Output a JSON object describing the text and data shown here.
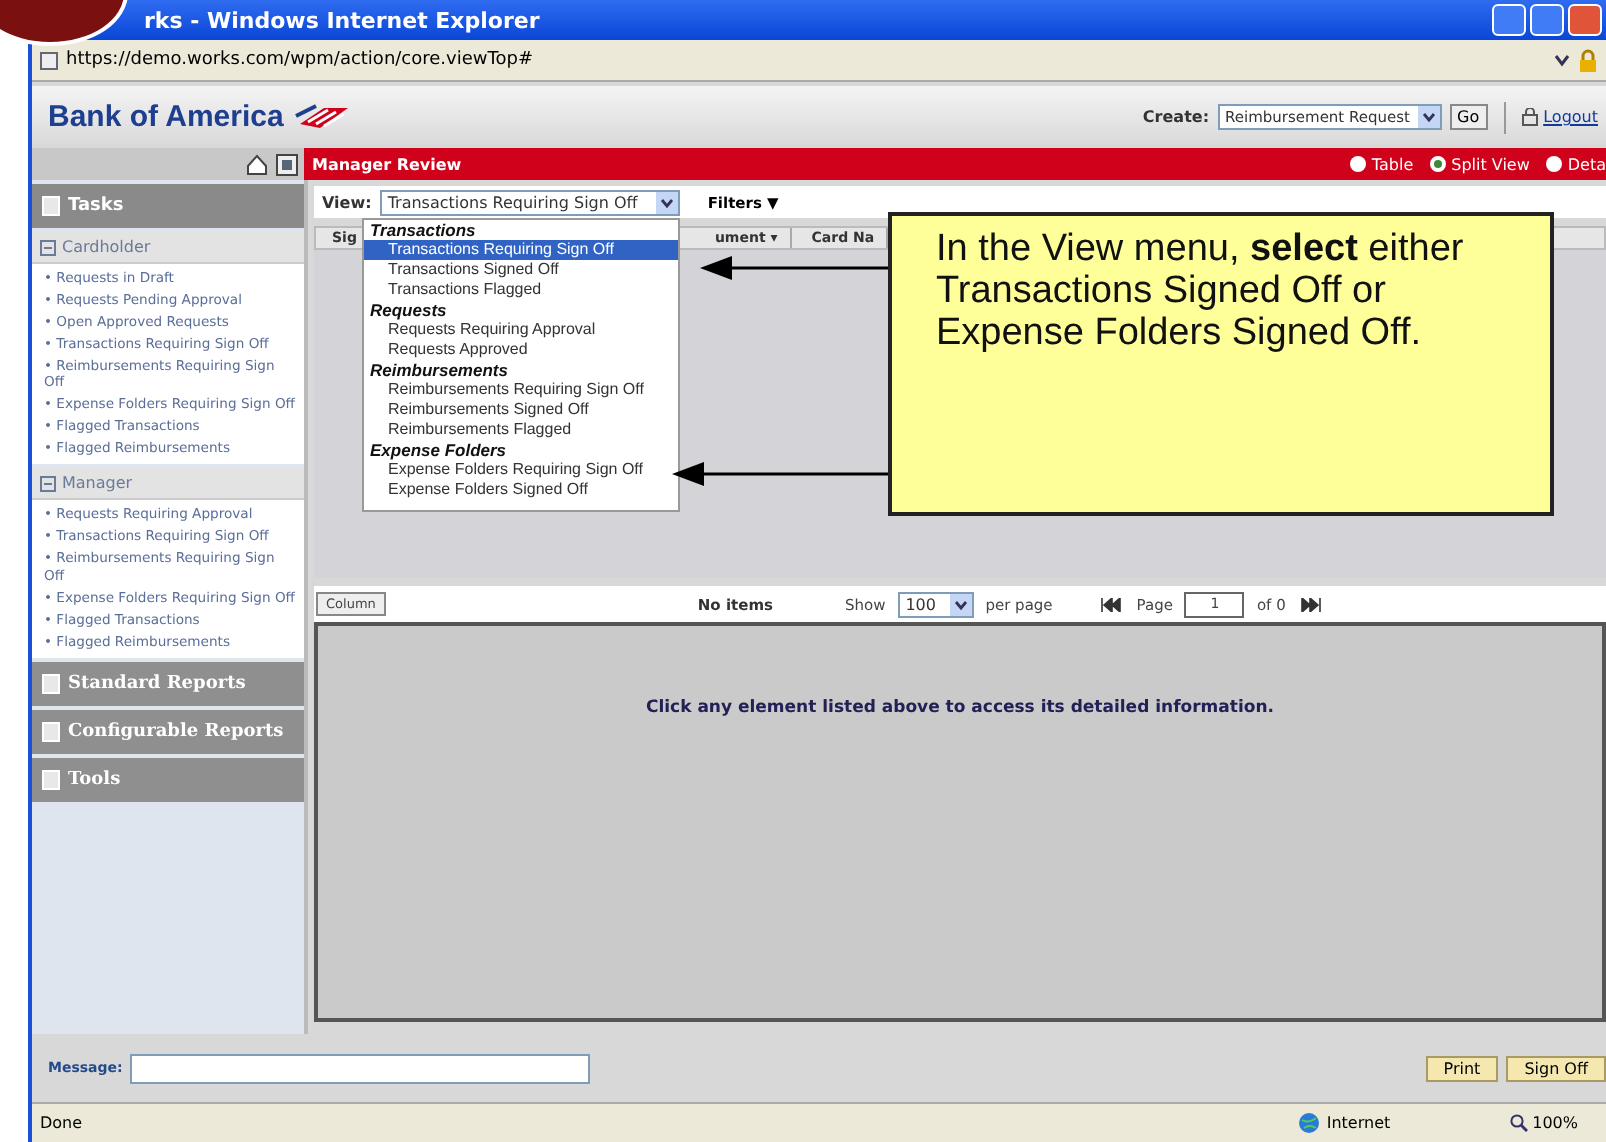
{
  "window": {
    "title": "rks - Windows Internet Explorer",
    "address": "https://demo.works.com/wpm/action/core.viewTop#"
  },
  "header": {
    "logo": "Bank of America",
    "create_label": "Create:",
    "create_value": "Reimbursement Request",
    "go": "Go",
    "logout": "Logout"
  },
  "page_title": "Manager Review",
  "view_modes": [
    {
      "label": "Table",
      "selected": false
    },
    {
      "label": "Split View",
      "selected": true
    },
    {
      "label": "Deta",
      "selected": false
    }
  ],
  "sidebar": {
    "title": "Tasks",
    "sections": [
      {
        "label": "Cardholder",
        "expanded": true,
        "items": [
          "• Requests in Draft",
          "• Requests Pending Approval",
          "• Open Approved Requests",
          "• Transactions Requiring Sign Off",
          "• Reimbursements Requiring Sign Off",
          "• Expense Folders Requiring Sign Off",
          "• Flagged Transactions",
          "• Flagged Reimbursements"
        ]
      },
      {
        "label": "Manager",
        "expanded": true,
        "items": [
          "• Requests Requiring Approval",
          "• Transactions Requiring Sign Off",
          "• Reimbursements Requiring Sign Off",
          "• Expense Folders Requiring Sign Off",
          "• Flagged Transactions",
          "• Flagged Reimbursements"
        ]
      }
    ],
    "panels": [
      "Standard Reports",
      "Configurable Reports",
      "Tools"
    ]
  },
  "view": {
    "label": "View:",
    "value": "Transactions Requiring Sign Off",
    "filters": "Filters ▼"
  },
  "table": {
    "columns": [
      "Sig",
      "ument ▾",
      "Card Na"
    ]
  },
  "view_menu": {
    "groups": [
      {
        "label": "Transactions",
        "items": [
          {
            "label": "Transactions Requiring Sign Off",
            "selected": true
          },
          {
            "label": "Transactions Signed Off",
            "selected": false
          },
          {
            "label": "Transactions Flagged",
            "selected": false
          }
        ]
      },
      {
        "label": "Requests",
        "items": [
          {
            "label": "Requests Requiring Approval",
            "selected": false
          },
          {
            "label": "Requests Approved",
            "selected": false
          }
        ]
      },
      {
        "label": "Reimbursements",
        "items": [
          {
            "label": "Reimbursements Requiring Sign Off",
            "selected": false
          },
          {
            "label": "Reimbursements Signed Off",
            "selected": false
          },
          {
            "label": "Reimbursements Flagged",
            "selected": false
          }
        ]
      },
      {
        "label": "Expense Folders",
        "items": [
          {
            "label": "Expense Folders Requiring Sign Off",
            "selected": false
          },
          {
            "label": "Expense Folders Signed Off",
            "selected": false
          }
        ]
      }
    ]
  },
  "callout": "In the View menu, **select** either Transactions Signed Off or Expense Folders Signed Off.",
  "toolbar": {
    "column_button": "Column",
    "count": "No items",
    "show": "Show",
    "per_page_value": "100",
    "per_page": "per page",
    "page": "Page",
    "page_value": "1",
    "of": "of 0"
  },
  "detail": {
    "message": "Click any element listed above to access its detailed information."
  },
  "footer": {
    "message_label": "Message:",
    "buttons": [
      "Print",
      "Sign Off"
    ]
  },
  "status_bar": {
    "status": "Done",
    "zone": "Internet",
    "zoom": "100%"
  }
}
